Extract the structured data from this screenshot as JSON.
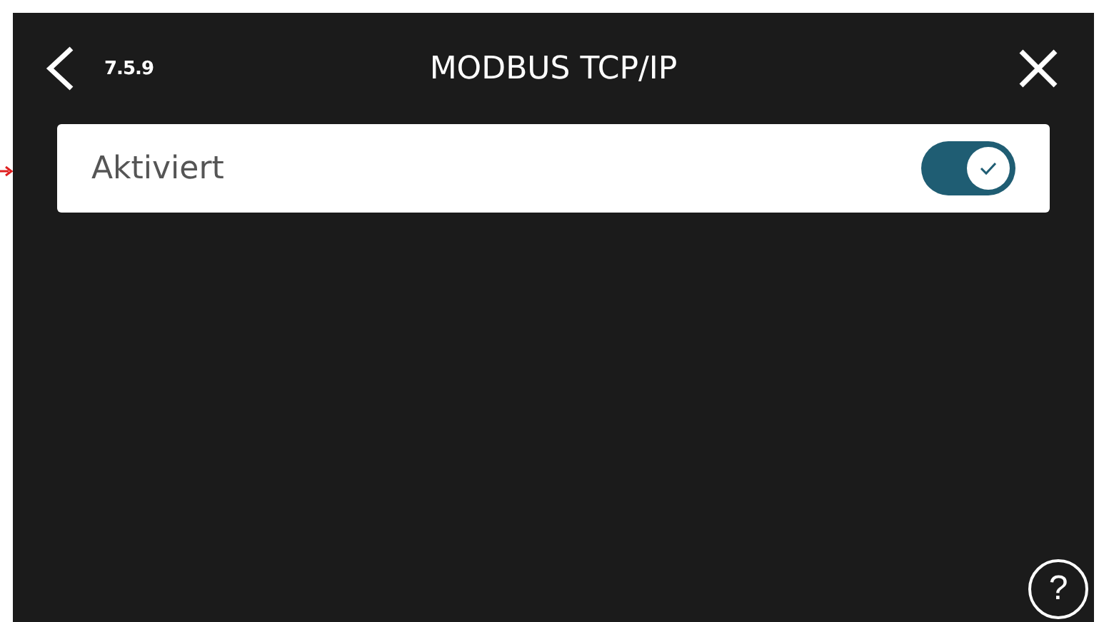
{
  "header": {
    "section": "7.5.9",
    "title": "MODBUS TCP/IP"
  },
  "settings": [
    {
      "kind": "toggle",
      "label": "Aktiviert",
      "on": true
    }
  ],
  "help": "?"
}
